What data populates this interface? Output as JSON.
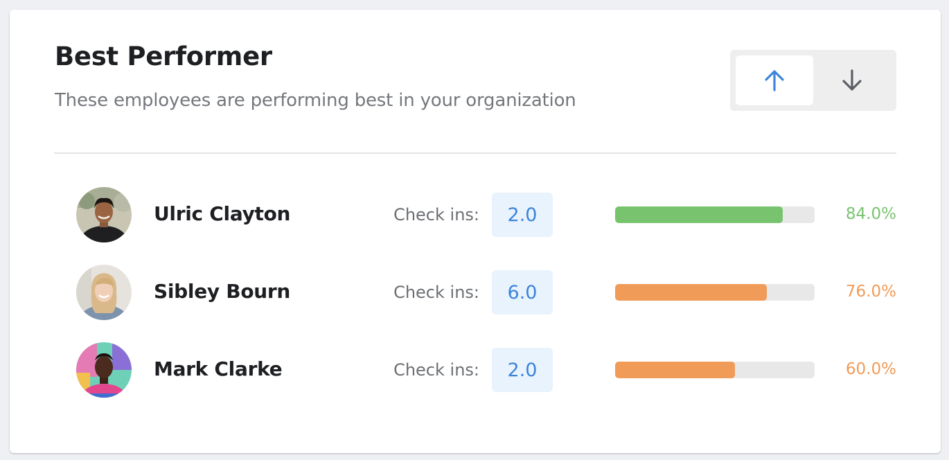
{
  "header": {
    "title": "Best Performer",
    "subtitle": "These employees are performing best in your organization"
  },
  "sort_toggle": {
    "active": "up",
    "up_icon": "arrow-up-icon",
    "down_icon": "arrow-down-icon"
  },
  "colors": {
    "accent": "#3b84db",
    "green": "#78c46e",
    "orange": "#f09b58"
  },
  "employees": [
    {
      "name": "Ulric Clayton",
      "checkins_label": "Check ins:",
      "checkins": "2.0",
      "percent_label": "84.0%",
      "percent": 84.0,
      "color": "#78c46e"
    },
    {
      "name": "Sibley Bourn",
      "checkins_label": "Check ins:",
      "checkins": "6.0",
      "percent_label": "76.0%",
      "percent": 76.0,
      "color": "#f09b58"
    },
    {
      "name": "Mark Clarke",
      "checkins_label": "Check ins:",
      "checkins": "2.0",
      "percent_label": "60.0%",
      "percent": 60.0,
      "color": "#f09b58"
    }
  ]
}
